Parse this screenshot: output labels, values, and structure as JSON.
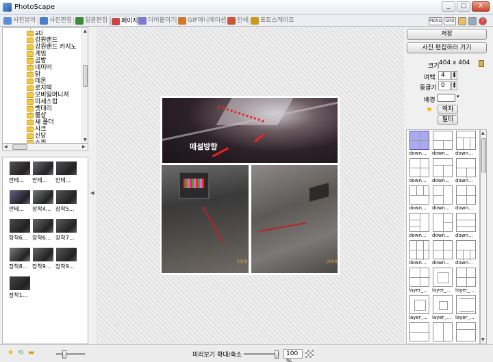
{
  "window": {
    "title": "PhotoScape",
    "minimize": "_",
    "maximize": "□",
    "close": "X"
  },
  "tabs": [
    {
      "label": "사진뷰어",
      "color": "#5a8fd8"
    },
    {
      "label": "사진편집",
      "color": "#4a7cc8"
    },
    {
      "label": "일괄편집",
      "color": "#3c8a3c"
    },
    {
      "label": "페이지",
      "color": "#cc4444",
      "active": true
    },
    {
      "label": "이어붙이기",
      "color": "#7a7ad0"
    },
    {
      "label": "GIF애니메이션",
      "color": "#d07a30"
    },
    {
      "label": "인쇄",
      "color": "#cc5533"
    },
    {
      "label": "포토스케이프",
      "color": "#c89a20"
    }
  ],
  "toolbar_icons": [
    "menu-icon",
    "grid-icon",
    "help-icon"
  ],
  "toolbar_labels": {
    "menu": "MENU",
    "grid": "GRD"
  },
  "folders": [
    "ati",
    "강원랜드",
    "강원랜드 카지노",
    "게임",
    "곰방",
    "네이버",
    "닭",
    "데몬",
    "로지텍",
    "모비일머니져",
    "미세스킴",
    "벳데리",
    "불샵",
    "새 폴더",
    "샤크",
    "신당",
    "쇼핑"
  ],
  "thumbnails": [
    {
      "caption": "안테...",
      "tone": "#5a5050"
    },
    {
      "caption": "안테...",
      "tone": "#6a6a70"
    },
    {
      "caption": "안테...",
      "tone": "#4e4e52"
    },
    {
      "caption": "안테...",
      "tone": "#6b5f8a"
    },
    {
      "caption": "장착4...",
      "tone": "#777a7a"
    },
    {
      "caption": "장착5...",
      "tone": "#555"
    },
    {
      "caption": "장착6...",
      "tone": "#4a4a4a"
    },
    {
      "caption": "장착6...",
      "tone": "#666"
    },
    {
      "caption": "장착7...",
      "tone": "#5c5c5c"
    },
    {
      "caption": "장착8...",
      "tone": "#7a7a7a"
    },
    {
      "caption": "장착9...",
      "tone": "#686868"
    },
    {
      "caption": "장착9...",
      "tone": "#585858"
    },
    {
      "caption": "장착1...",
      "tone": "#444"
    }
  ],
  "canvas": {
    "caption": "매설방향",
    "stamp_bl": "2008",
    "stamp_br": "2008"
  },
  "right_panel": {
    "save_label": "저장",
    "edit_label": "사진 편집하러 가기",
    "size_label": "크기",
    "size_value": "404 x 404",
    "margin_label": "여백",
    "margin_value": "4",
    "round_label": "둥글기",
    "round_value": "0",
    "background_label": "배경",
    "frame_label": "액자",
    "filter_label": "필터"
  },
  "templates": [
    {
      "name": "down...",
      "selected": true
    },
    {
      "name": "down..."
    },
    {
      "name": "down..."
    },
    {
      "name": "down..."
    },
    {
      "name": "down..."
    },
    {
      "name": "down..."
    },
    {
      "name": "down..."
    },
    {
      "name": "down..."
    },
    {
      "name": "down..."
    },
    {
      "name": "down..."
    },
    {
      "name": "down..."
    },
    {
      "name": "down..."
    },
    {
      "name": "down..."
    },
    {
      "name": "down..."
    },
    {
      "name": "down..."
    },
    {
      "name": "layer_..."
    },
    {
      "name": "layer_..."
    },
    {
      "name": "layer_..."
    },
    {
      "name": "layer_..."
    },
    {
      "name": "layer_..."
    },
    {
      "name": "layer_..."
    },
    {
      "name": ""
    },
    {
      "name": ""
    },
    {
      "name": ""
    }
  ],
  "statusbar": {
    "zoom_label": "미리보기 확대/축소",
    "zoom_value": "100 %"
  }
}
